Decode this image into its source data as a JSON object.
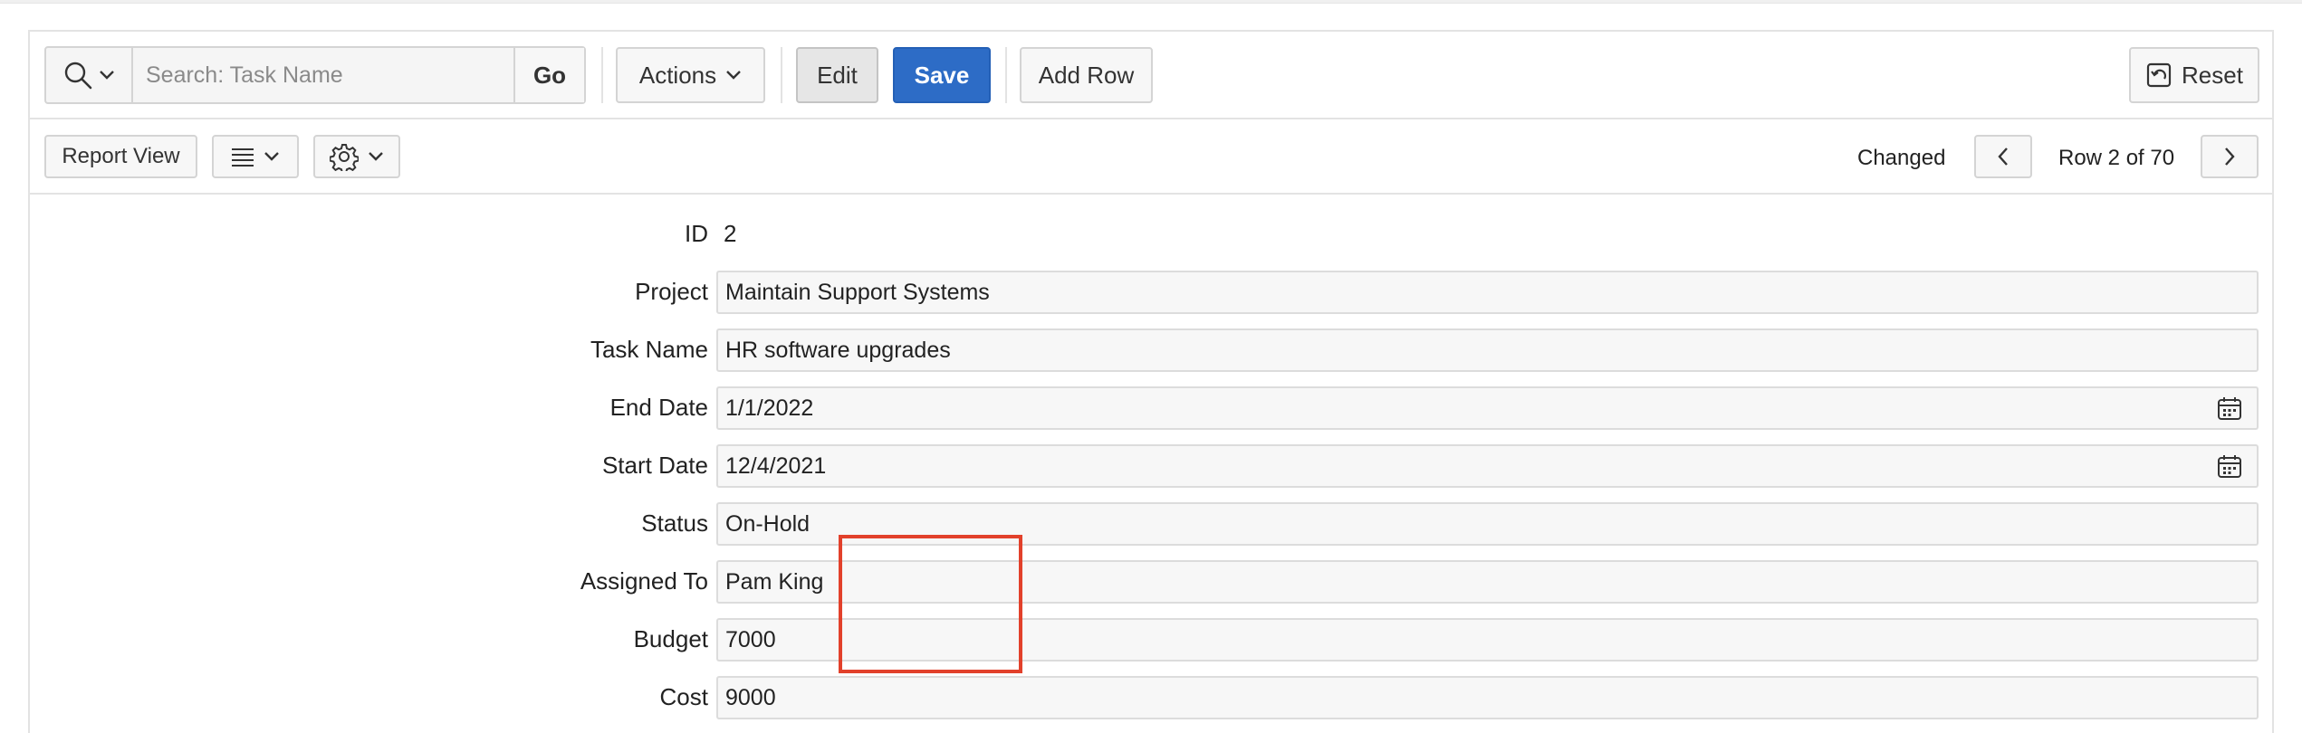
{
  "search": {
    "placeholder": "Search: Task Name",
    "value": "",
    "go_label": "Go"
  },
  "toolbar": {
    "actions_label": "Actions",
    "edit_label": "Edit",
    "save_label": "Save",
    "add_row_label": "Add Row",
    "reset_label": "Reset"
  },
  "subtoolbar": {
    "report_view_label": "Report View",
    "status_text": "Changed",
    "row_indicator": "Row 2 of 70"
  },
  "form": {
    "fields": [
      {
        "label": "ID",
        "value": "2"
      },
      {
        "label": "Project",
        "value": "Maintain Support Systems"
      },
      {
        "label": "Task Name",
        "value": "HR software upgrades"
      },
      {
        "label": "End Date",
        "value": "1/1/2022"
      },
      {
        "label": "Start Date",
        "value": "12/4/2021"
      },
      {
        "label": "Status",
        "value": "On-Hold"
      },
      {
        "label": "Assigned To",
        "value": "Pam King"
      },
      {
        "label": "Budget",
        "value": "7000"
      },
      {
        "label": "Cost",
        "value": "9000"
      }
    ]
  },
  "colors": {
    "primary": "#2d6cc6",
    "highlight": "#e2412b"
  },
  "icons": [
    "search-icon",
    "chevron-down-icon",
    "lines-icon",
    "gear-icon",
    "reset-icon",
    "chevron-left-icon",
    "chevron-right-icon",
    "calendar-icon"
  ]
}
